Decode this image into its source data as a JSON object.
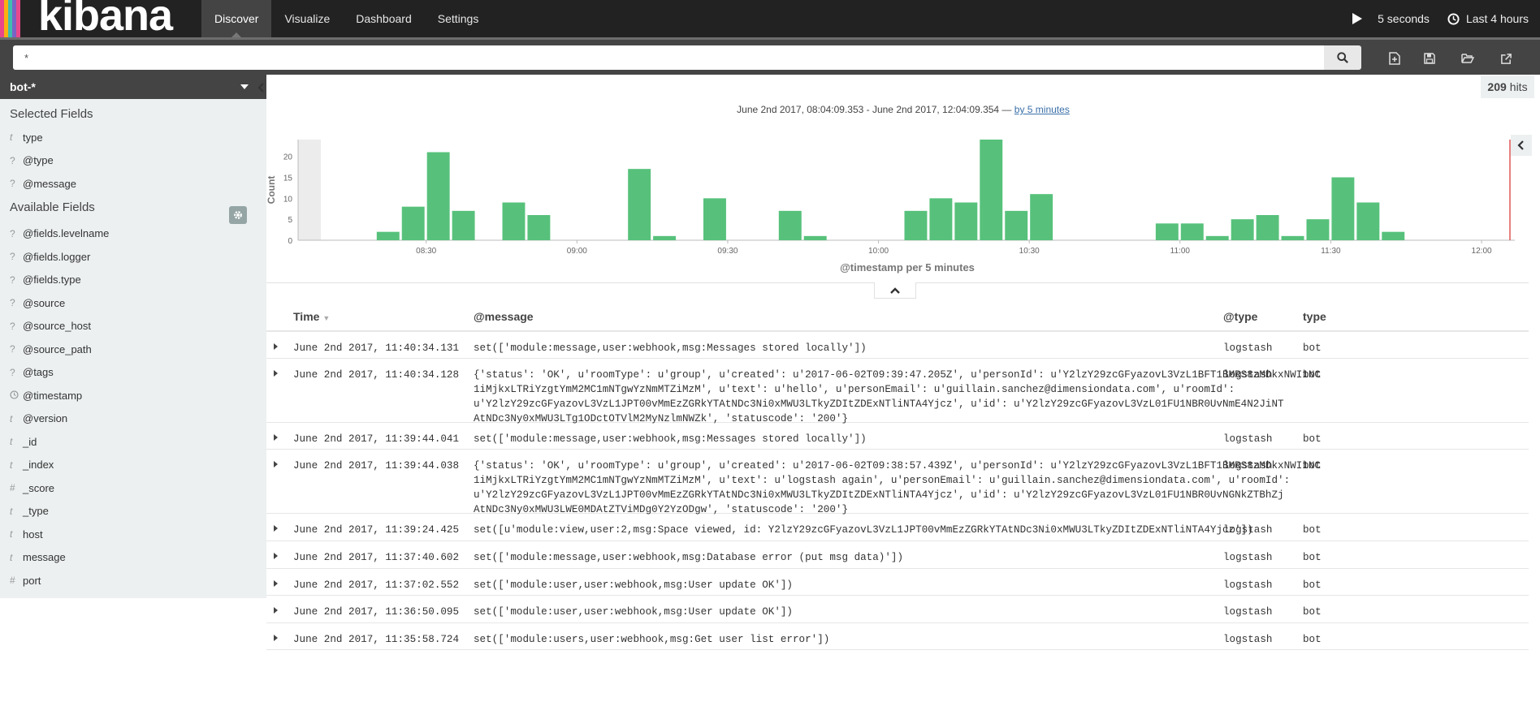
{
  "app": {
    "logo_text": "kibana",
    "stripe_colors": [
      "#e8488b",
      "#f9b110",
      "#3ebeb0",
      "#7b62c4",
      "#e8488b"
    ]
  },
  "nav": {
    "tabs": [
      "Discover",
      "Visualize",
      "Dashboard",
      "Settings"
    ],
    "active_tab": "Discover",
    "refresh_label": "5 seconds",
    "time_label": "Last 4 hours"
  },
  "query": {
    "value": "*"
  },
  "sidebar": {
    "index_pattern": "bot-*",
    "selected_title": "Selected Fields",
    "selected_fields": [
      {
        "type": "t",
        "name": "type"
      },
      {
        "type": "?",
        "name": "@type"
      },
      {
        "type": "?",
        "name": "@message"
      }
    ],
    "available_title": "Available Fields",
    "available_fields": [
      {
        "type": "?",
        "name": "@fields.levelname"
      },
      {
        "type": "?",
        "name": "@fields.logger"
      },
      {
        "type": "?",
        "name": "@fields.type"
      },
      {
        "type": "?",
        "name": "@source"
      },
      {
        "type": "?",
        "name": "@source_host"
      },
      {
        "type": "?",
        "name": "@source_path"
      },
      {
        "type": "?",
        "name": "@tags"
      },
      {
        "type": "clock",
        "name": "@timestamp"
      },
      {
        "type": "t",
        "name": "@version"
      },
      {
        "type": "t",
        "name": "_id"
      },
      {
        "type": "t",
        "name": "_index"
      },
      {
        "type": "#",
        "name": "_score"
      },
      {
        "type": "t",
        "name": "_type"
      },
      {
        "type": "t",
        "name": "host"
      },
      {
        "type": "t",
        "name": "message"
      },
      {
        "type": "#",
        "name": "port"
      }
    ]
  },
  "hits": {
    "count": "209",
    "label": "hits"
  },
  "time_range": {
    "text": "June 2nd 2017, 08:04:09.353 - June 2nd 2017, 12:04:09.354 — ",
    "interval_link": "by 5 minutes"
  },
  "chart_data": {
    "type": "bar",
    "ylabel": "Count",
    "xlabel": "@timestamp per 5 minutes",
    "ylim": [
      0,
      24
    ],
    "yticks": [
      0,
      5,
      10,
      15,
      20
    ],
    "x_start": "08:05",
    "x_end": "12:05",
    "bucket_minutes": 5,
    "xtick_labels": [
      "08:30",
      "09:00",
      "09:30",
      "10:00",
      "10:30",
      "11:00",
      "11:30",
      "12:00"
    ],
    "xtick_minutes": [
      510,
      540,
      570,
      600,
      630,
      660,
      690,
      720
    ],
    "bars": [
      {
        "start": "08:20",
        "minute": 500,
        "value": 2
      },
      {
        "start": "08:25",
        "minute": 505,
        "value": 8
      },
      {
        "start": "08:30",
        "minute": 510,
        "value": 21
      },
      {
        "start": "08:35",
        "minute": 515,
        "value": 7
      },
      {
        "start": "08:45",
        "minute": 525,
        "value": 9
      },
      {
        "start": "08:50",
        "minute": 530,
        "value": 6
      },
      {
        "start": "09:10",
        "minute": 550,
        "value": 17
      },
      {
        "start": "09:15",
        "minute": 555,
        "value": 1
      },
      {
        "start": "09:25",
        "minute": 565,
        "value": 10
      },
      {
        "start": "09:40",
        "minute": 580,
        "value": 7
      },
      {
        "start": "09:45",
        "minute": 585,
        "value": 1
      },
      {
        "start": "10:05",
        "minute": 605,
        "value": 7
      },
      {
        "start": "10:10",
        "minute": 610,
        "value": 10
      },
      {
        "start": "10:15",
        "minute": 615,
        "value": 9
      },
      {
        "start": "10:20",
        "minute": 620,
        "value": 24
      },
      {
        "start": "10:25",
        "minute": 625,
        "value": 7
      },
      {
        "start": "10:30",
        "minute": 630,
        "value": 11
      },
      {
        "start": "10:55",
        "minute": 655,
        "value": 4
      },
      {
        "start": "11:00",
        "minute": 660,
        "value": 4
      },
      {
        "start": "11:05",
        "minute": 665,
        "value": 1
      },
      {
        "start": "11:10",
        "minute": 670,
        "value": 5
      },
      {
        "start": "11:15",
        "minute": 675,
        "value": 6
      },
      {
        "start": "11:20",
        "minute": 680,
        "value": 1
      },
      {
        "start": "11:25",
        "minute": 685,
        "value": 5
      },
      {
        "start": "11:30",
        "minute": 690,
        "value": 15
      },
      {
        "start": "11:35",
        "minute": 695,
        "value": 9
      },
      {
        "start": "11:40",
        "minute": 700,
        "value": 2
      }
    ],
    "bar_color": "#57c17b",
    "now_marker_color": "#e05555"
  },
  "table": {
    "headers": {
      "time": "Time",
      "message": "@message",
      "atype": "@type",
      "type": "type"
    },
    "rows": [
      {
        "time": "June 2nd 2017, 11:40:34.131",
        "message": "set(['module:message,user:webhook,msg:Messages stored locally'])",
        "atype": "logstash",
        "type": "bot"
      },
      {
        "time": "June 2nd 2017, 11:40:34.128",
        "message": "{'status': 'OK', u'roomType': u'group', u'created': u'2017-06-02T09:39:47.205Z', u'personId': u'Y2lzY29zcGFyazovL3VzL1BFT1BMRS8zMDkxNWI1NC\n1iMjkxLTRiYzgtYmM2MC1mNTgwYzNmMTZiMzM', u'text': u'hello', u'personEmail': u'guillain.sanchez@dimensiondata.com', u'roomId':\nu'Y2lzY29zcGFyazovL3VzL1JPT00vMmEzZGRkYTAtNDc3Ni0xMWU3LTkyZDItZDExNTliNTA4Yjcz', u'id': u'Y2lzY29zcGFyazovL3VzL01FU1NBR0UvNmE4N2JiNT\nAtNDc3Ny0xMWU3LTg1ODctOTVlM2MyNzlmNWZk', 'statuscode': '200'}",
        "atype": "logstash",
        "type": "bot"
      },
      {
        "time": "June 2nd 2017, 11:39:44.041",
        "message": "set(['module:message,user:webhook,msg:Messages stored locally'])",
        "atype": "logstash",
        "type": "bot"
      },
      {
        "time": "June 2nd 2017, 11:39:44.038",
        "message": "{'status': 'OK', u'roomType': u'group', u'created': u'2017-06-02T09:38:57.439Z', u'personId': u'Y2lzY29zcGFyazovL3VzL1BFT1BMRS8zMDkxNWI1NC\n1iMjkxLTRiYzgtYmM2MC1mNTgwYzNmMTZiMzM', u'text': u'logstash again', u'personEmail': u'guillain.sanchez@dimensiondata.com', u'roomId':\nu'Y2lzY29zcGFyazovL3VzL1JPT00vMmEzZGRkYTAtNDc3Ni0xMWU3LTkyZDItZDExNTliNTA4Yjcz', u'id': u'Y2lzY29zcGFyazovL3VzL01FU1NBR0UvNGNkZTBhZj\nAtNDc3Ny0xMWU3LWE0MDAtZTViMDg0Y2YzODgw', 'statuscode': '200'}",
        "atype": "logstash",
        "type": "bot"
      },
      {
        "time": "June 2nd 2017, 11:39:24.425",
        "message": "set([u'module:view,user:2,msg:Space viewed, id: Y2lzY29zcGFyazovL3VzL1JPT00vMmEzZGRkYTAtNDc3Ni0xMWU3LTkyZDItZDExNTliNTA4Yjcz'])",
        "atype": "logstash",
        "type": "bot"
      },
      {
        "time": "June 2nd 2017, 11:37:40.602",
        "message": "set(['module:message,user:webhook,msg:Database error (put msg data)'])",
        "atype": "logstash",
        "type": "bot"
      },
      {
        "time": "June 2nd 2017, 11:37:02.552",
        "message": "set(['module:user,user:webhook,msg:User update OK'])",
        "atype": "logstash",
        "type": "bot"
      },
      {
        "time": "June 2nd 2017, 11:36:50.095",
        "message": "set(['module:user,user:webhook,msg:User update OK'])",
        "atype": "logstash",
        "type": "bot"
      },
      {
        "time": "June 2nd 2017, 11:35:58.724",
        "message": "set(['module:users,user:webhook,msg:Get user list error'])",
        "atype": "logstash",
        "type": "bot"
      }
    ]
  }
}
